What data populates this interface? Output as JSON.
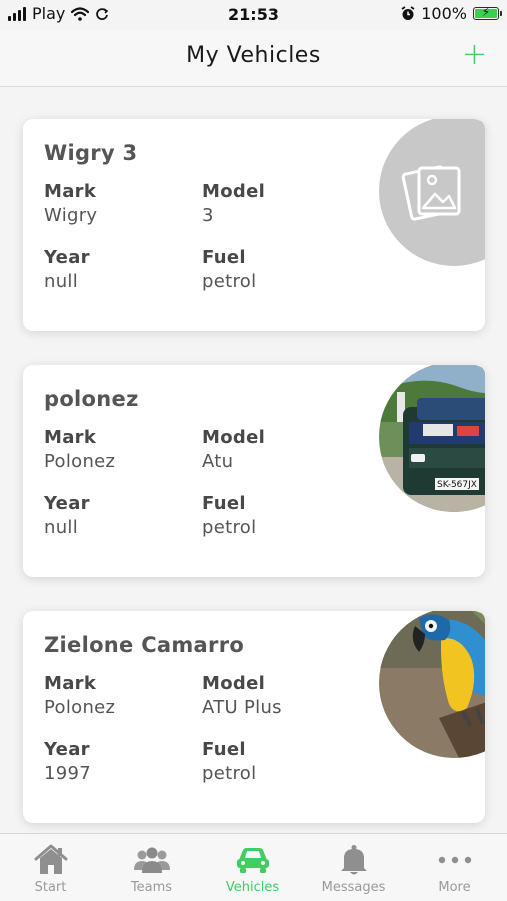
{
  "status_bar": {
    "carrier": "Play",
    "time": "21:53",
    "battery": "100%",
    "battery_level": 1.0
  },
  "header": {
    "title": "My Vehicles",
    "add_label": "+"
  },
  "vehicles": [
    {
      "name": "Wigry 3",
      "mark_label": "Mark",
      "mark": "Wigry",
      "model_label": "Model",
      "model": "3",
      "year_label": "Year",
      "year": "null",
      "fuel_label": "Fuel",
      "fuel": "petrol",
      "image": "placeholder-image-icon"
    },
    {
      "name": "polonez",
      "mark_label": "Mark",
      "mark": "Polonez",
      "model_label": "Model",
      "model": "Atu",
      "year_label": "Year",
      "year": "null",
      "fuel_label": "Fuel",
      "fuel": "petrol",
      "image": "rally-car-photo",
      "plate": "SK-567JX"
    },
    {
      "name": "Zielone Camarro",
      "mark_label": "Mark",
      "mark": "Polonez",
      "model_label": "Model",
      "model": "ATU Plus",
      "year_label": "Year",
      "year": "1997",
      "fuel_label": "Fuel",
      "fuel": "petrol",
      "image": "parrot-photo"
    }
  ],
  "tabs": [
    {
      "label": "Start",
      "icon": "home-icon",
      "active": false
    },
    {
      "label": "Teams",
      "icon": "people-icon",
      "active": false
    },
    {
      "label": "Vehicles",
      "icon": "car-icon",
      "active": true
    },
    {
      "label": "Messages",
      "icon": "bell-icon",
      "active": false
    },
    {
      "label": "More",
      "icon": "more-icon",
      "active": false
    }
  ],
  "colors": {
    "accent": "#3fce62",
    "inactive_tab": "#9a9a9a",
    "card_bg": "#ffffff",
    "page_bg": "#f4f4f4"
  }
}
